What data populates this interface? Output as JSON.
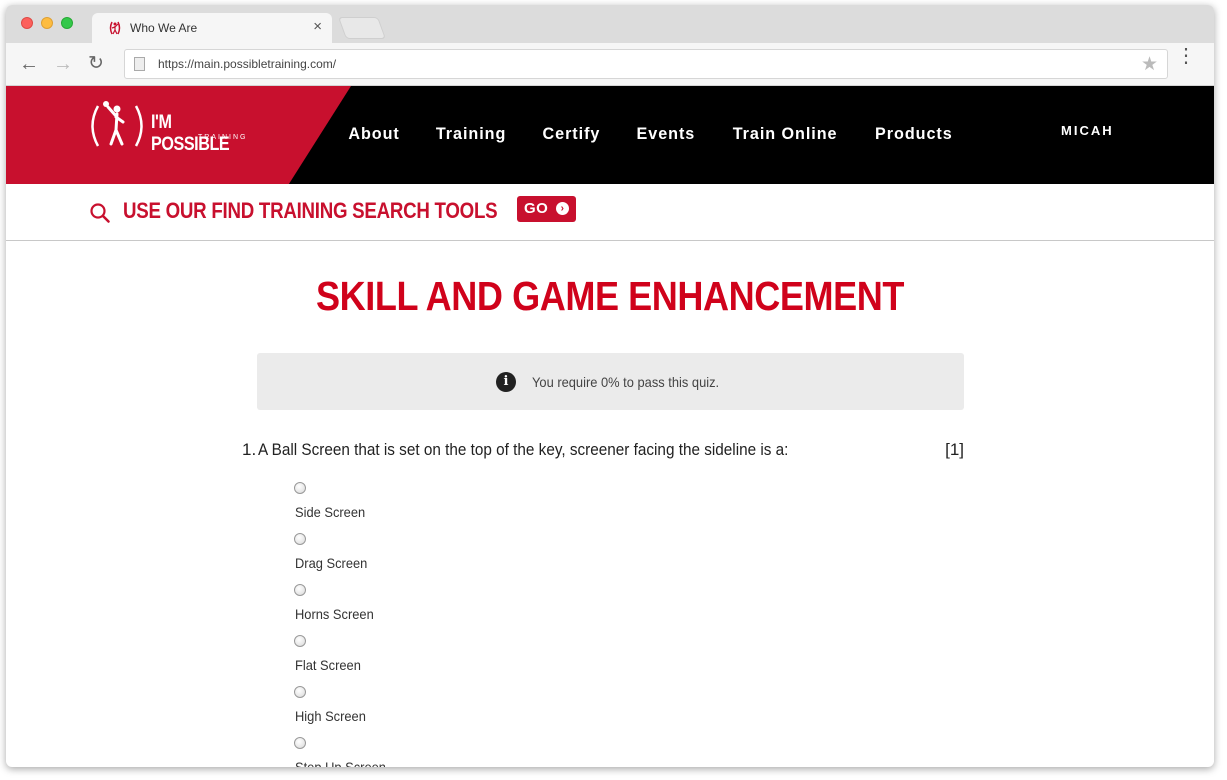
{
  "browser": {
    "tab_title": "Who We Are",
    "tab_close": "×",
    "url": "https://main.possibletraining.com/",
    "back_glyph": "←",
    "forward_glyph": "→",
    "reload_glyph": "↻",
    "star_glyph": "★",
    "menu_glyph": "⋮"
  },
  "header": {
    "logo_text": "I'M POSSIBLE",
    "logo_subtext": "TRAINING",
    "nav": [
      "About",
      "Training",
      "Certify",
      "Events",
      "Train Online",
      "Products"
    ],
    "user_name": "MICAH",
    "brand_color": "#c8102e"
  },
  "search_strip": {
    "text": "USE OUR FIND TRAINING SEARCH TOOLS",
    "go_label": "GO",
    "go_glyph": "›"
  },
  "main": {
    "title": "SKILL AND GAME ENHANCEMENT",
    "notice": {
      "icon_glyph": "i",
      "text": "You require 0% to pass this quiz."
    },
    "question": {
      "number": "1.",
      "text": "A Ball Screen that is set on the top of the key, screener facing the sideline is a:",
      "points": "[1]",
      "options": [
        "Side Screen",
        "Drag Screen",
        "Horns Screen",
        "Flat Screen",
        "High Screen",
        "Step Up Screen"
      ]
    }
  }
}
